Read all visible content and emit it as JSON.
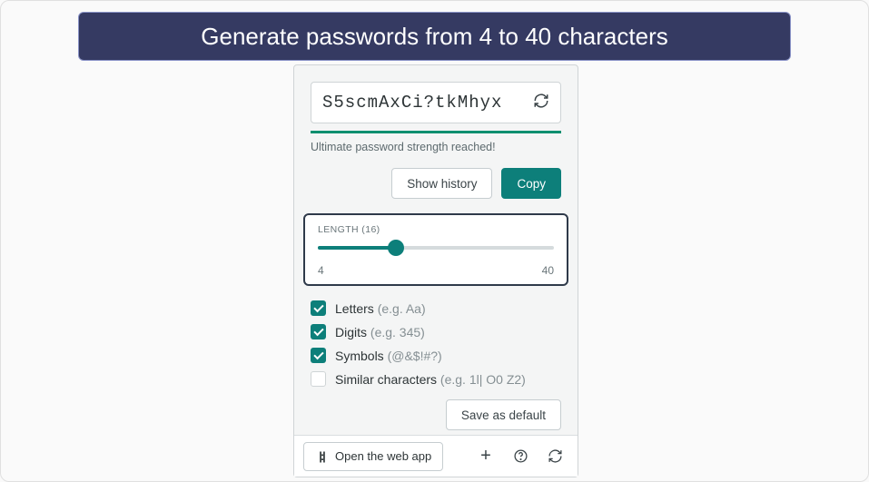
{
  "banner": {
    "text": "Generate passwords from 4 to 40 characters"
  },
  "generator": {
    "password": "S5scmAxCi?tkMhyx",
    "strength_text": "Ultimate password strength reached!",
    "show_history_label": "Show history",
    "copy_label": "Copy"
  },
  "length": {
    "label": "LENGTH (16)",
    "min": "4",
    "max": "40",
    "value": 16
  },
  "options": {
    "letters": {
      "label": "Letters ",
      "hint": "(e.g. Aa)",
      "checked": true
    },
    "digits": {
      "label": "Digits ",
      "hint": "(e.g. 345)",
      "checked": true
    },
    "symbols": {
      "label": "Symbols ",
      "hint": "(@&$!#?)",
      "checked": true
    },
    "similar": {
      "label": "Similar characters ",
      "hint": "(e.g. 1l| O0 Z2)",
      "checked": false
    }
  },
  "save_default_label": "Save as default",
  "footer": {
    "open_app_label": "Open the web app"
  }
}
